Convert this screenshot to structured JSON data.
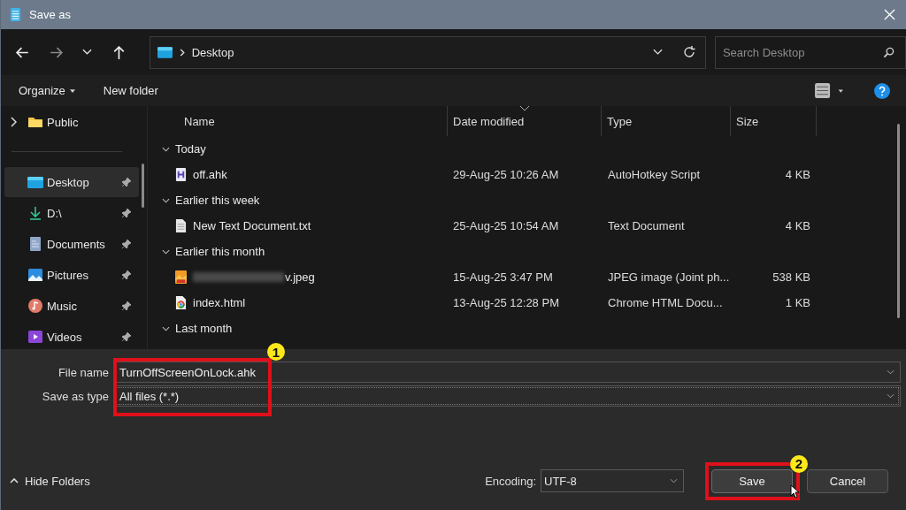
{
  "window": {
    "title": "Save as"
  },
  "nav": {
    "forward_disabled": true
  },
  "address": {
    "path": [
      "Desktop"
    ]
  },
  "search": {
    "placeholder": "Search Desktop"
  },
  "toolbar": {
    "organize": "Organize",
    "new_folder": "New folder"
  },
  "sidebar": {
    "items": [
      {
        "label": "Public",
        "kind": "folder",
        "expandable": true,
        "pinned": false,
        "selected": false
      },
      {
        "label": "Desktop",
        "kind": "desktop",
        "expandable": false,
        "pinned": true,
        "selected": true
      },
      {
        "label": "D:\\",
        "kind": "download",
        "expandable": false,
        "pinned": true,
        "selected": false
      },
      {
        "label": "Documents",
        "kind": "documents",
        "expandable": false,
        "pinned": true,
        "selected": false
      },
      {
        "label": "Pictures",
        "kind": "pictures",
        "expandable": false,
        "pinned": true,
        "selected": false
      },
      {
        "label": "Music",
        "kind": "music",
        "expandable": false,
        "pinned": true,
        "selected": false
      },
      {
        "label": "Videos",
        "kind": "videos",
        "expandable": false,
        "pinned": true,
        "selected": false
      }
    ]
  },
  "columns": [
    {
      "label": "Name",
      "sorted": false
    },
    {
      "label": "Date modified",
      "sorted": true
    },
    {
      "label": "Type",
      "sorted": false
    },
    {
      "label": "Size",
      "sorted": false
    }
  ],
  "groups": [
    {
      "label": "Today",
      "expanded": true,
      "files": [
        {
          "name": "off.ahk",
          "kind": "script",
          "blurred": false,
          "date": "29-Aug-25 10:26 AM",
          "type": "AutoHotkey Script",
          "size": "4 KB"
        }
      ]
    },
    {
      "label": "Earlier this week",
      "expanded": true,
      "files": [
        {
          "name": "New Text Document.txt",
          "kind": "text",
          "blurred": false,
          "date": "25-Aug-25 10:54 AM",
          "type": "Text Document",
          "size": "4 KB"
        }
      ]
    },
    {
      "label": "Earlier this month",
      "expanded": true,
      "files": [
        {
          "name": "v.jpeg",
          "kind": "image",
          "blurred": true,
          "date": "15-Aug-25 3:47 PM",
          "type": "JPEG image (Joint ph...",
          "size": "538 KB"
        },
        {
          "name": "index.html",
          "kind": "html",
          "blurred": false,
          "date": "13-Aug-25 12:28 PM",
          "type": "Chrome HTML Docu...",
          "size": "1 KB"
        }
      ]
    },
    {
      "label": "Last month",
      "expanded": true
    }
  ],
  "form": {
    "file_name": {
      "label": "File name",
      "value": "TurnOffScreenOnLock.ahk"
    },
    "save_type": {
      "label": "Save as type",
      "value": "All files  (*.*)"
    }
  },
  "hide_folders": "Hide Folders",
  "encoding": {
    "label": "Encoding:",
    "value": "UTF-8"
  },
  "buttons": [
    {
      "label": "Save",
      "kind": "primary"
    },
    {
      "label": "Cancel",
      "kind": "cancel"
    }
  ],
  "annotations": [
    {
      "number": "1"
    },
    {
      "number": "2"
    }
  ]
}
